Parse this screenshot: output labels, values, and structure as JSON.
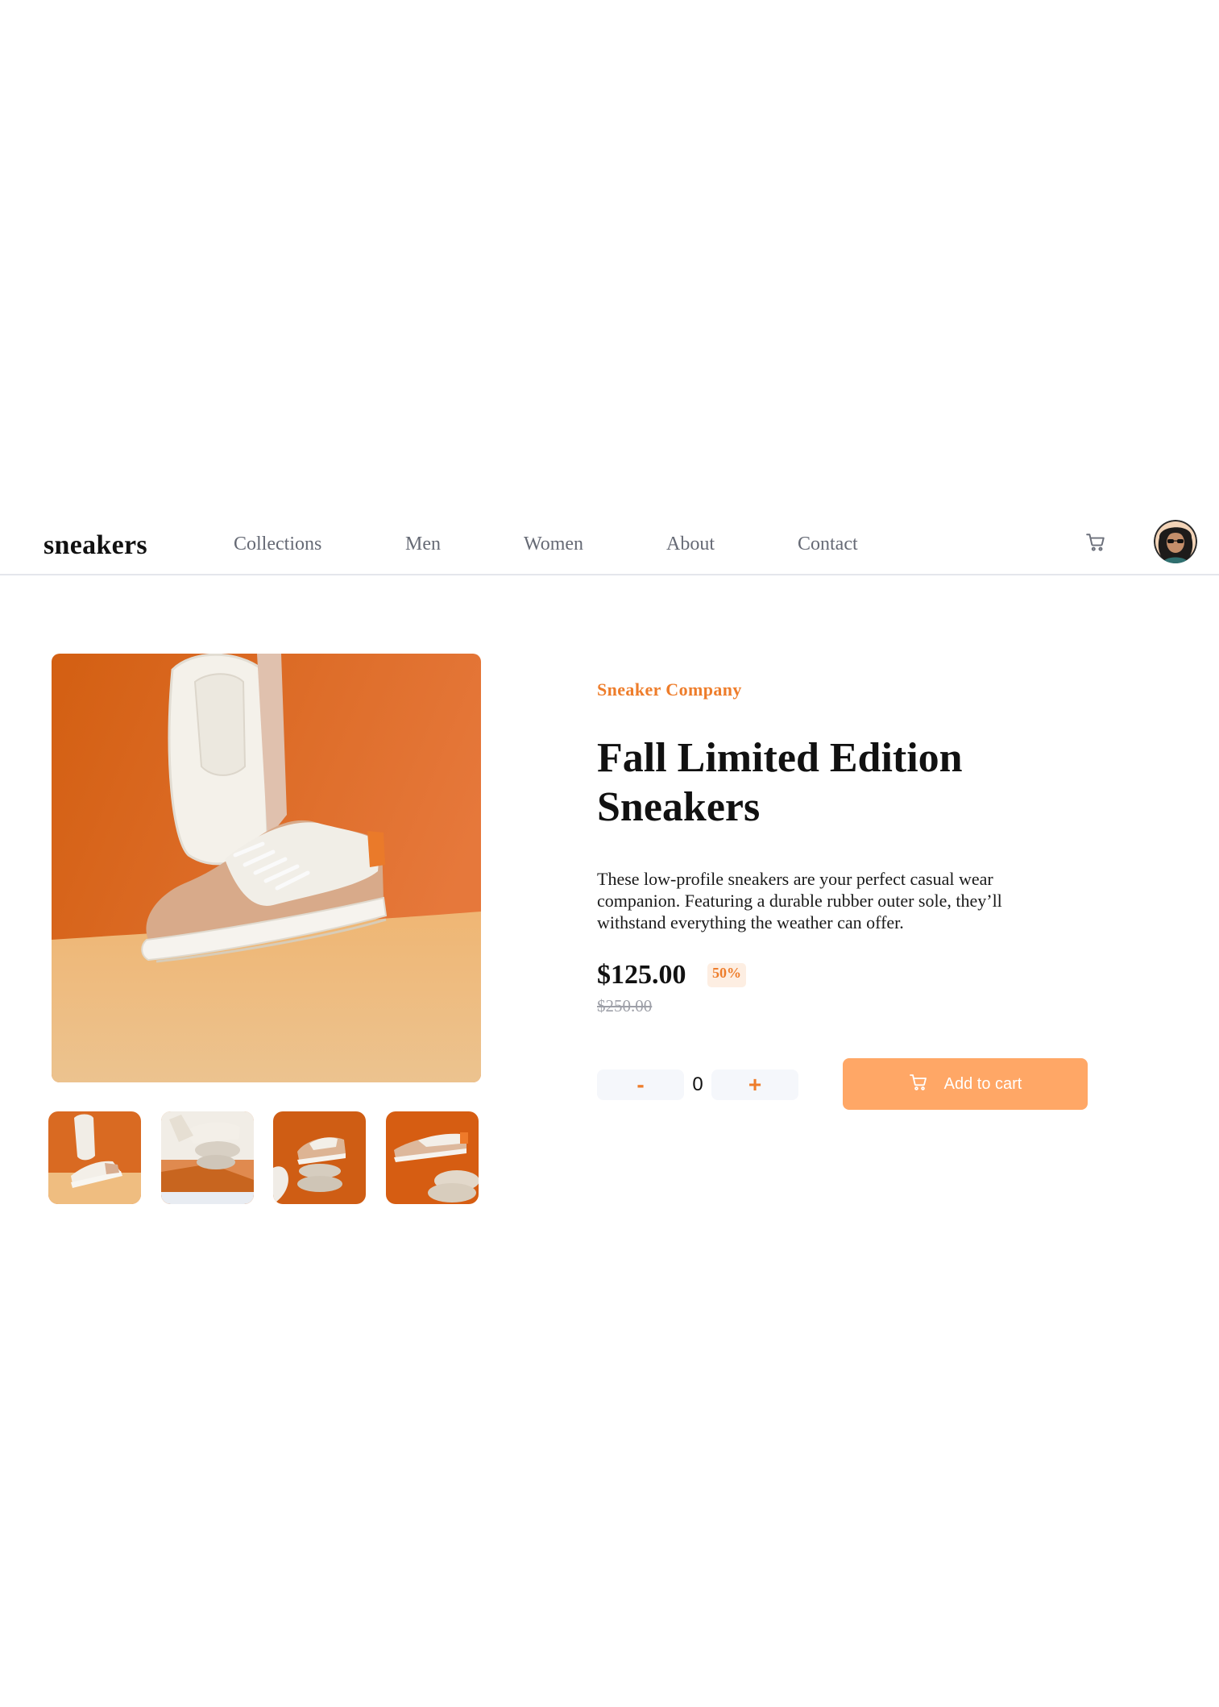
{
  "header": {
    "logo": "sneakers",
    "nav": [
      {
        "label": "Collections"
      },
      {
        "label": "Men"
      },
      {
        "label": "Women"
      },
      {
        "label": "About"
      },
      {
        "label": "Contact"
      }
    ],
    "cart_icon": "cart-icon",
    "avatar_icon": "user-avatar"
  },
  "gallery": {
    "main_image": "product-image-1",
    "thumbnails": [
      "product-thumbnail-1",
      "product-thumbnail-2",
      "product-thumbnail-3",
      "product-thumbnail-4"
    ]
  },
  "product": {
    "company": "Sneaker Company",
    "title": "Fall Limited Edition Sneakers",
    "description": "These low-profile sneakers are your perfect casual wear companion. Featuring a durable rubber outer sole, they’ll withstand everything the weather can offer.",
    "price": "$125.00",
    "discount": "50%",
    "original_price": "$250.00"
  },
  "cart_controls": {
    "minus_label": "-",
    "quantity": "0",
    "plus_label": "+",
    "add_label": "Add to cart",
    "add_icon": "cart-icon"
  },
  "colors": {
    "accent": "#ee7d2b",
    "button": "#ffa766",
    "discount_bg": "#fdeee2",
    "muted_text": "#666a75"
  }
}
